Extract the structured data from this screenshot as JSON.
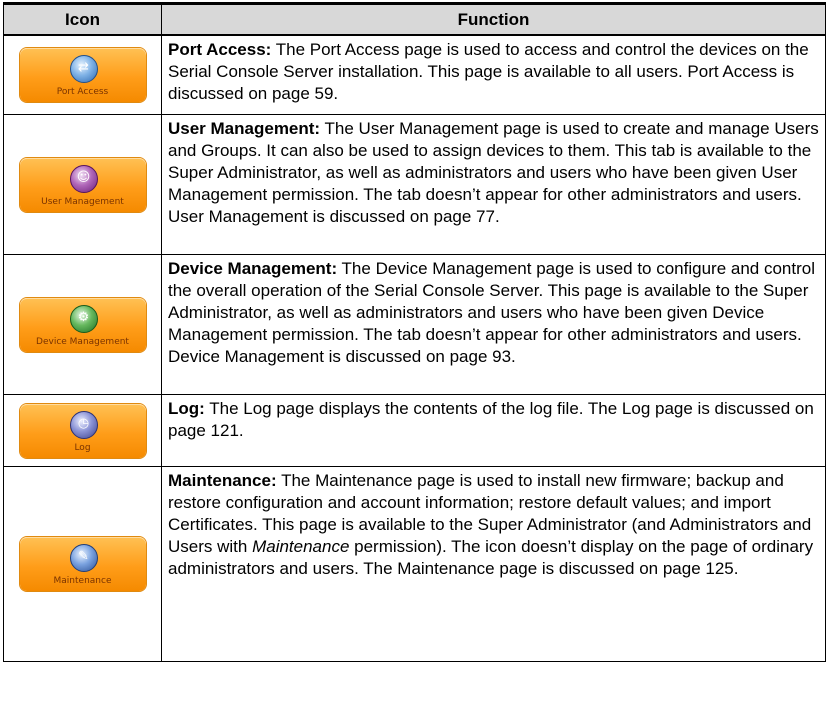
{
  "table": {
    "header": {
      "icon": "Icon",
      "function": "Function"
    },
    "rows": [
      {
        "icon_label": "Port Access",
        "icon_name": "port-access-icon",
        "title": "Port Access:",
        "text": "The Port Access page is used to access and control the devices on the Serial Console Server installation. This page is available to all users. Port Access is discussed on page 59."
      },
      {
        "icon_label": "User Management",
        "icon_name": "user-management-icon",
        "title": "User Management:",
        "text": "The User Management page is used to create and manage Users and Groups. It can also be used to assign devices to them. This tab is available to the Super Administrator, as well as administrators and users who have been given User Management permission. The tab doesn’t appear for other administrators and users. User Management is discussed on page 77."
      },
      {
        "icon_label": "Device Management",
        "icon_name": "device-management-icon",
        "title": "Device Management:",
        "text": "The Device Management page is used to configure and control the overall operation of the Serial Console Server. This page is available to the Super Administrator, as well as administrators and users who have been given Device Management permission. The tab doesn’t appear for other administrators and users. Device Management is discussed on page 93."
      },
      {
        "icon_label": "Log",
        "icon_name": "log-icon",
        "title": "Log:",
        "text": "The Log page displays the contents of the log file. The Log page is discussed on page 121."
      },
      {
        "icon_label": "Maintenance",
        "icon_name": "maintenance-icon",
        "title": "Maintenance:",
        "text_before": "The Maintenance page is used to install new firmware; backup and restore configuration and account information; restore default values; and import Certificates. This page is available to the Super Administrator (and Administrators and Users with ",
        "text_italic": "Maintenance",
        "text_after": " permission). The icon doesn’t display on the page of ordinary administrators and users. The Maintenance page is discussed on page 125."
      }
    ]
  },
  "colors": {
    "button_orange": "#ff9d19",
    "header_gray": "#d8d8d8"
  }
}
